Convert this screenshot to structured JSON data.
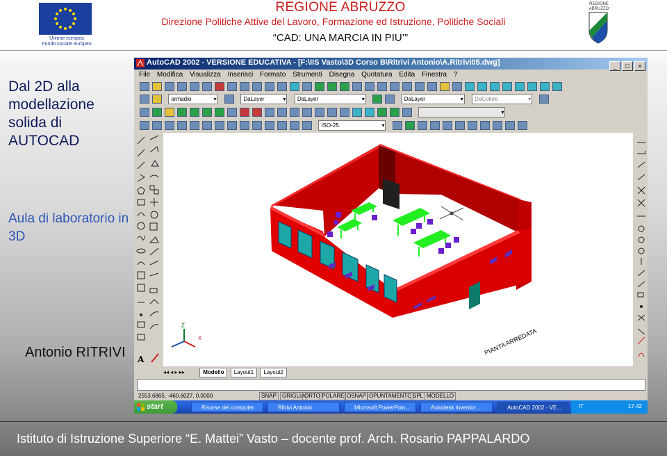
{
  "header": {
    "eu_caption_1": "Unione europea",
    "eu_caption_2": "Fondo sociale europeo",
    "region_title": "REGIONE ABRUZZO",
    "region_subtitle": "Direzione Politiche Attive del Lavoro, Formazione ed Istruzione, Politiche Sociali",
    "project_title": "“CAD: UNA MARCIA IN PIU’”",
    "abruzzo_logo_text": "REGIONE ABRUZZO"
  },
  "slide": {
    "title": "Dal 2D alla modellazione solida di AUTOCAD",
    "subtitle": "Aula di laboratorio in 3D",
    "author": "Antonio RITRIVI",
    "footer": "Istituto di Istruzione Superiore “E. Mattei” Vasto – docente prof. Arch. Rosario PAPPALARDO"
  },
  "autocad": {
    "window_title": "AutoCAD 2002 - VERSIONE EDUCATIVA - [F:\\IIS Vasto\\3D Corso B\\Ritrivi Antonio\\A.Ritrivi05.dwg]",
    "menu": [
      "File",
      "Modifica",
      "Visualizza",
      "Inserisci",
      "Formato",
      "Strumenti",
      "Disegna",
      "Quotatura",
      "Edita",
      "Finestra",
      "?"
    ],
    "layer_combo": "armadio",
    "color_combo": "DaLayer",
    "linetype_combo": "DaLayer",
    "lineweight_combo": "DaLayer",
    "plotstyle_combo": "DaColore",
    "dimstyle_combo": "ISO-25",
    "layout_tabs": [
      "Modello",
      "Layout1",
      "Layout2"
    ],
    "drawing_label": "PIANTA ARREDATA",
    "ucs_z": "Z",
    "ucs_x": "X",
    "coordinates": "2553.6865, -460.6027, 0.0000",
    "status_modes": [
      "SNAP",
      "GRIGLIA",
      "ORTO",
      "POLARE",
      "OSNAP",
      "OPUNTAMENTO",
      "SPL",
      "MODELLO"
    ]
  },
  "taskbar": {
    "start": "start",
    "items": [
      "Risorse del computer",
      "Ritrivi Antonio",
      "Microsoft PowerPoin...",
      "Autodesk Inventor ...",
      "AutoCAD 2002 - VE..."
    ],
    "language": "IT",
    "clock": "17.42"
  },
  "colors": {
    "region_red": "#cc1b1b",
    "title_navy": "#0d1a5b",
    "subtitle_blue": "#2e57b8",
    "wall_red": "#e00000",
    "desk_green": "#22ee22",
    "chair_purple": "#6a1fd0",
    "window_teal": "#1ea7a7"
  }
}
